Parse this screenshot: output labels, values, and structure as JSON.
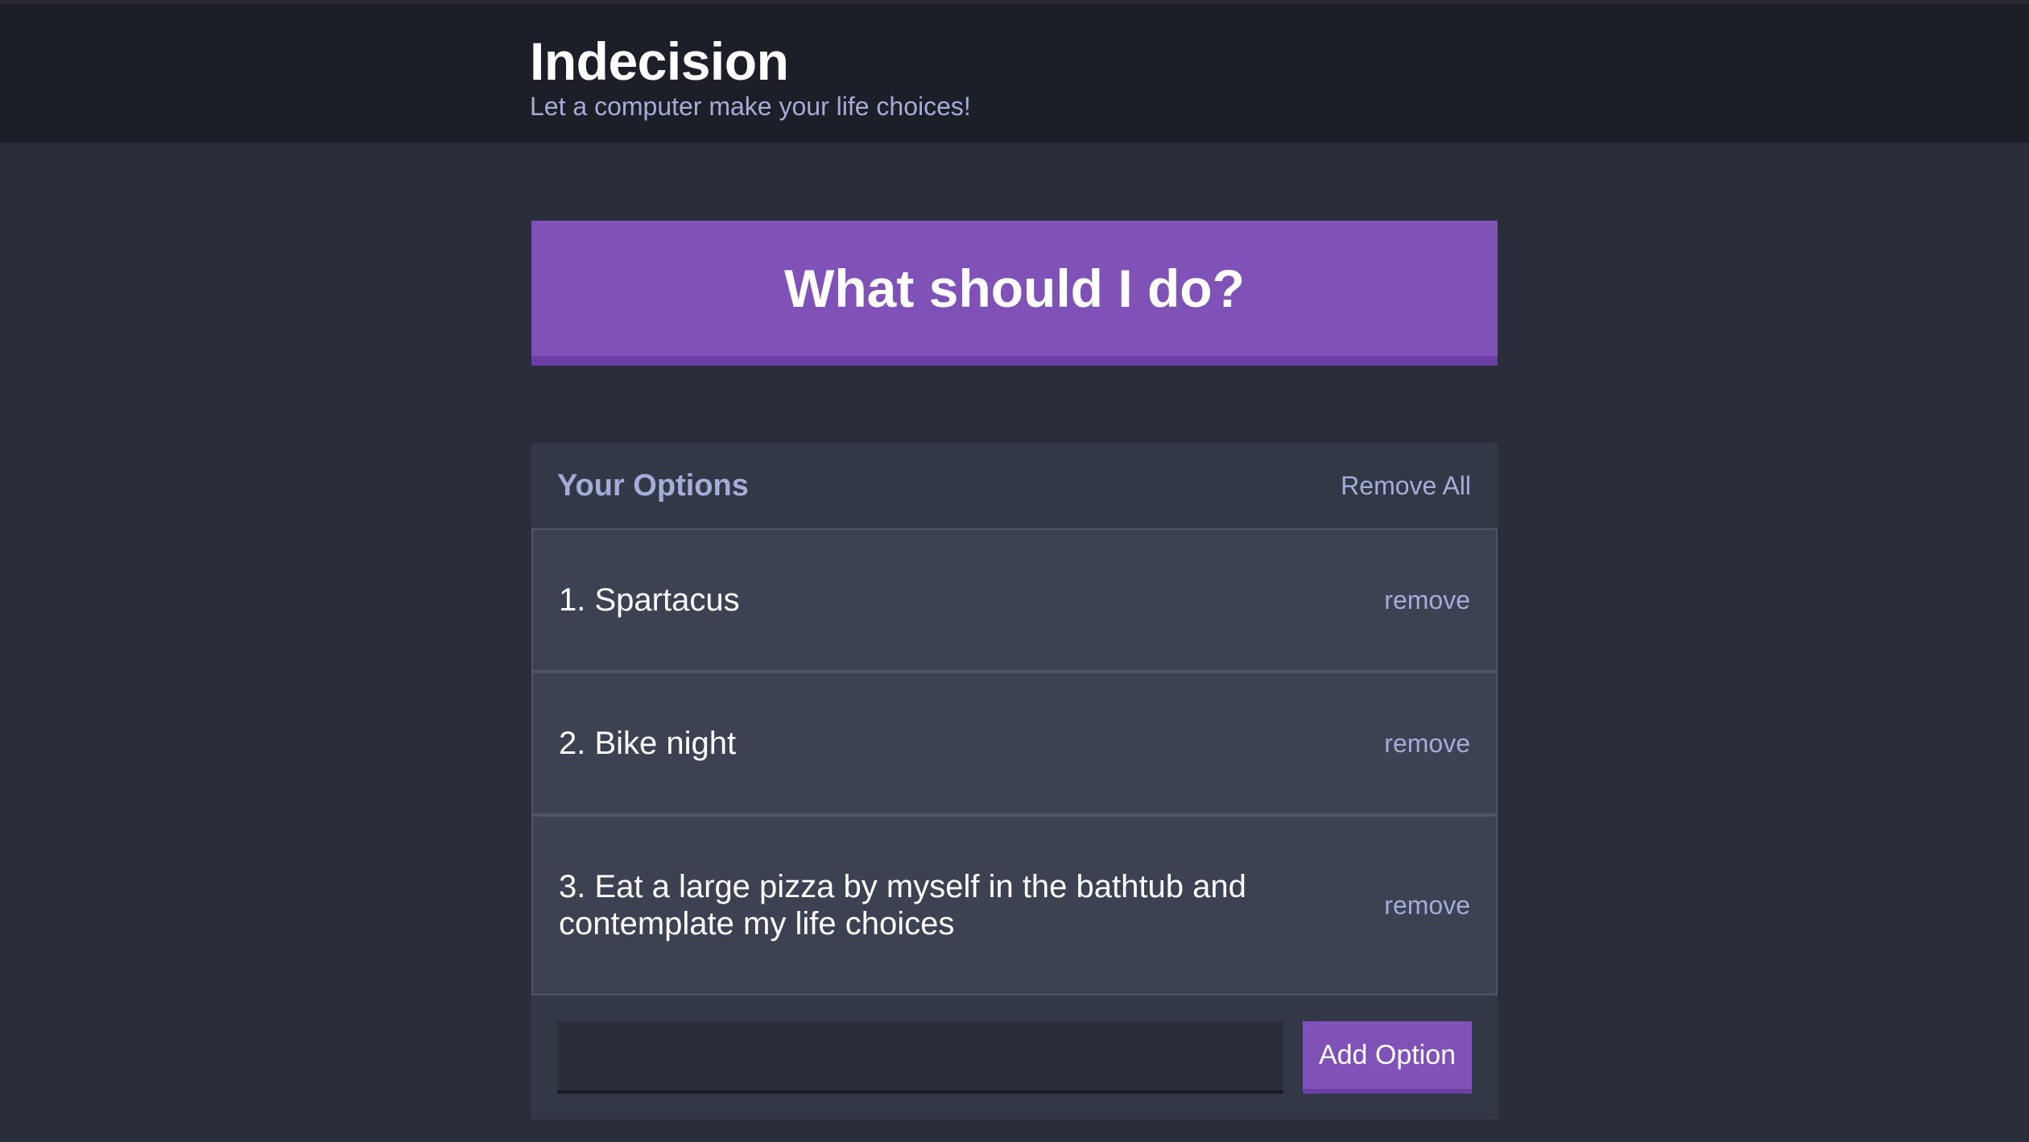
{
  "header": {
    "title": "Indecision",
    "subtitle": "Let a computer make your life choices!"
  },
  "action": {
    "label": "What should I do?"
  },
  "options_widget": {
    "title": "Your Options",
    "remove_all_label": "Remove All",
    "items": [
      {
        "text": "1. Spartacus",
        "remove_label": "remove"
      },
      {
        "text": "2. Bike night",
        "remove_label": "remove"
      },
      {
        "text": "3. Eat a large pizza by myself in the bathtub and contemplate my life choices",
        "remove_label": "remove"
      }
    ],
    "add_input_value": "",
    "add_input_placeholder": "",
    "add_button_label": "Add Option"
  },
  "colors": {
    "accent": "#8052b8",
    "header_bg": "#1c1f27",
    "page_bg": "#2a2e3a",
    "widget_bg": "#333846",
    "option_bg": "#3d4253",
    "muted_text": "#a5acd8"
  }
}
